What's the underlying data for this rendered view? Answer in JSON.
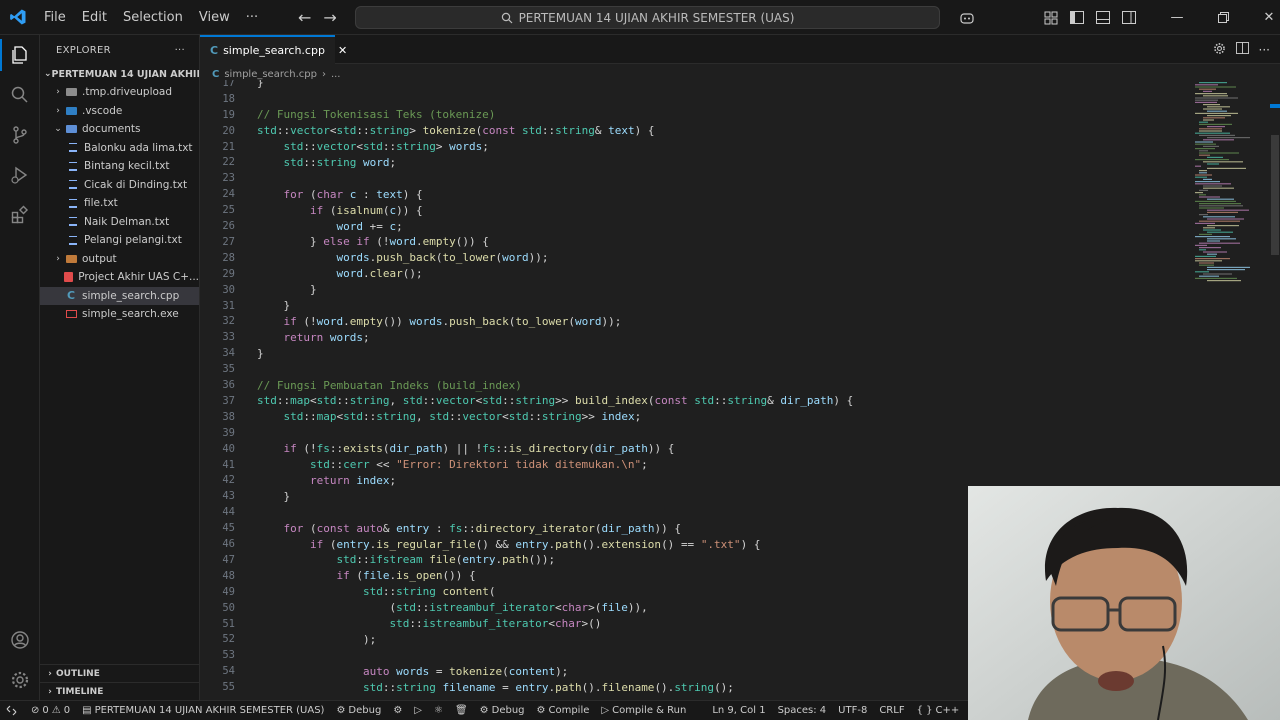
{
  "title_bar": {
    "menu": [
      "File",
      "Edit",
      "Selection",
      "View",
      "···"
    ],
    "search_text": "PERTEMUAN 14 UJIAN AKHIR SEMESTER (UAS)"
  },
  "explorer": {
    "header": "EXPLORER",
    "more": "···",
    "root": "PERTEMUAN 14 UJIAN AKHIR ...",
    "items": [
      {
        "label": ".tmp.driveupload",
        "type": "folder",
        "depth": 1,
        "expanded": false
      },
      {
        "label": ".vscode",
        "type": "folder-vscode",
        "depth": 1,
        "expanded": false
      },
      {
        "label": "documents",
        "type": "folder-docs",
        "depth": 1,
        "expanded": true
      },
      {
        "label": "Balonku ada lima.txt",
        "type": "txt",
        "depth": 2
      },
      {
        "label": "Bintang kecil.txt",
        "type": "txt",
        "depth": 2
      },
      {
        "label": "Cicak di Dinding.txt",
        "type": "txt",
        "depth": 2
      },
      {
        "label": "file.txt",
        "type": "txt",
        "depth": 2
      },
      {
        "label": "Naik Delman.txt",
        "type": "txt",
        "depth": 2
      },
      {
        "label": "Pelangi pelangi.txt",
        "type": "txt",
        "depth": 2
      },
      {
        "label": "output",
        "type": "folder-out",
        "depth": 1,
        "expanded": false
      },
      {
        "label": "Project Akhir UAS C+...",
        "type": "pdf",
        "depth": 1
      },
      {
        "label": "simple_search.cpp",
        "type": "cpp",
        "depth": 1,
        "selected": true
      },
      {
        "label": "simple_search.exe",
        "type": "exe",
        "depth": 1
      }
    ],
    "outline": "OUTLINE",
    "timeline": "TIMELINE"
  },
  "editor": {
    "tab_label": "simple_search.cpp",
    "breadcrumb_file": "simple_search.cpp",
    "breadcrumb_more": "...",
    "lines": [
      {
        "n": "17",
        "t": "}"
      },
      {
        "n": "18",
        "t": ""
      },
      {
        "n": "19",
        "t": "// Fungsi Tokenisasi Teks (tokenize)"
      },
      {
        "n": "20",
        "t": "std::vector<std::string> tokenize(const std::string& text) {"
      },
      {
        "n": "21",
        "t": "    std::vector<std::string> words;"
      },
      {
        "n": "22",
        "t": "    std::string word;"
      },
      {
        "n": "23",
        "t": ""
      },
      {
        "n": "24",
        "t": "    for (char c : text) {"
      },
      {
        "n": "25",
        "t": "        if (isalnum(c)) {"
      },
      {
        "n": "26",
        "t": "            word += c;"
      },
      {
        "n": "27",
        "t": "        } else if (!word.empty()) {"
      },
      {
        "n": "28",
        "t": "            words.push_back(to_lower(word));"
      },
      {
        "n": "29",
        "t": "            word.clear();"
      },
      {
        "n": "30",
        "t": "        }"
      },
      {
        "n": "31",
        "t": "    }"
      },
      {
        "n": "32",
        "t": "    if (!word.empty()) words.push_back(to_lower(word));"
      },
      {
        "n": "33",
        "t": "    return words;"
      },
      {
        "n": "34",
        "t": "}"
      },
      {
        "n": "35",
        "t": ""
      },
      {
        "n": "36",
        "t": "// Fungsi Pembuatan Indeks (build_index)"
      },
      {
        "n": "37",
        "t": "std::map<std::string, std::vector<std::string>> build_index(const std::string& dir_path) {"
      },
      {
        "n": "38",
        "t": "    std::map<std::string, std::vector<std::string>> index;"
      },
      {
        "n": "39",
        "t": ""
      },
      {
        "n": "40",
        "t": "    if (!fs::exists(dir_path) || !fs::is_directory(dir_path)) {"
      },
      {
        "n": "41",
        "t": "        std::cerr << \"Error: Direktori tidak ditemukan.\\n\";"
      },
      {
        "n": "42",
        "t": "        return index;"
      },
      {
        "n": "43",
        "t": "    }"
      },
      {
        "n": "44",
        "t": ""
      },
      {
        "n": "45",
        "t": "    for (const auto& entry : fs::directory_iterator(dir_path)) {"
      },
      {
        "n": "46",
        "t": "        if (entry.is_regular_file() && entry.path().extension() == \".txt\") {"
      },
      {
        "n": "47",
        "t": "            std::ifstream file(entry.path());"
      },
      {
        "n": "48",
        "t": "            if (file.is_open()) {"
      },
      {
        "n": "49",
        "t": "                std::string content("
      },
      {
        "n": "50",
        "t": "                    (std::istreambuf_iterator<char>(file)),"
      },
      {
        "n": "51",
        "t": "                    std::istreambuf_iterator<char>()"
      },
      {
        "n": "52",
        "t": "                );"
      },
      {
        "n": "53",
        "t": ""
      },
      {
        "n": "54",
        "t": "                auto words = tokenize(content);"
      },
      {
        "n": "55",
        "t": "                std::string filename = entry.path().filename().string();"
      }
    ]
  },
  "status_bar": {
    "errors": "0",
    "warnings": "0",
    "folder": "PERTEMUAN 14 UJIAN AKHIR SEMESTER (UAS)",
    "debug1": "Debug",
    "debug2": "Debug",
    "compile": "Compile",
    "compile_run": "Compile & Run",
    "cursor": "Ln 9, Col 1",
    "spaces": "Spaces: 4",
    "encoding": "UTF-8",
    "eol": "CRLF",
    "language": "C++"
  },
  "colors": {
    "accent": "#0078d4",
    "keyword": "#c586c0",
    "type": "#4ec9b0",
    "function": "#dcdcaa",
    "string": "#ce9178",
    "comment": "#6a9955",
    "variable": "#9cdcfe"
  }
}
